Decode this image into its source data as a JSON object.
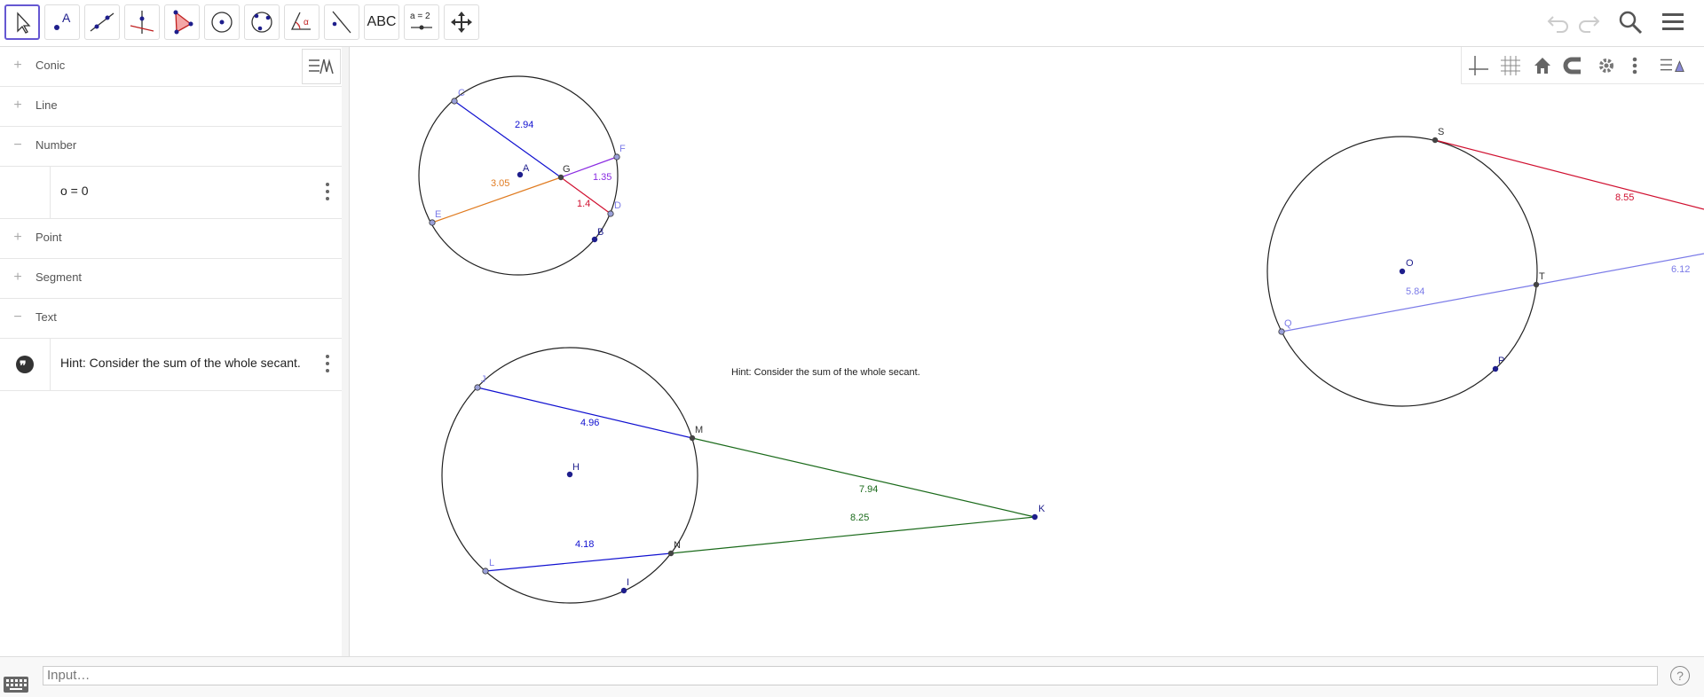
{
  "toolbar": {
    "tools": [
      {
        "name": "move-tool"
      },
      {
        "name": "point-tool",
        "text": "A"
      },
      {
        "name": "line-tool"
      },
      {
        "name": "perpendicular-line-tool"
      },
      {
        "name": "polygon-tool"
      },
      {
        "name": "circle-center-point-tool"
      },
      {
        "name": "circle-three-points-tool"
      },
      {
        "name": "angle-tool",
        "text": "α"
      },
      {
        "name": "reflect-tool"
      },
      {
        "name": "text-tool",
        "text": "ABC"
      },
      {
        "name": "slider-tool",
        "text": "a = 2"
      },
      {
        "name": "move-graphics-view-tool"
      }
    ],
    "right_icons": [
      "undo-icon",
      "redo-icon",
      "search-icon",
      "menu-icon"
    ]
  },
  "algebra": {
    "groups": [
      {
        "label": "Conic",
        "expanded": false
      },
      {
        "label": "Line",
        "expanded": false
      },
      {
        "label": "Number",
        "expanded": true,
        "items": [
          {
            "value": "o = 0"
          }
        ]
      },
      {
        "label": "Point",
        "expanded": false
      },
      {
        "label": "Segment",
        "expanded": false
      },
      {
        "label": "Text",
        "expanded": true,
        "items": [
          {
            "value": "Hint: Consider the sum of the whole secant."
          }
        ]
      }
    ]
  },
  "graphics": {
    "hint_text": "Hint: Consider the sum of the whole secant.",
    "colors": {
      "blue": "#1010d0",
      "orange": "#e07b20",
      "purple": "#8a2be2",
      "red": "#d01030",
      "green": "#1a6a1a",
      "lavender": "#7b7be8",
      "point_dark": "#1e1e8c"
    },
    "figure1": {
      "points": [
        "C",
        "A",
        "G",
        "F",
        "E",
        "D",
        "B"
      ],
      "labels": [
        "2.94",
        "3.05",
        "1.35",
        "1.4"
      ]
    },
    "figure2": {
      "points": [
        "J",
        "H",
        "M",
        "K",
        "L",
        "N",
        "I"
      ],
      "labels": [
        "4.96",
        "7.94",
        "8.25",
        "4.18"
      ]
    },
    "figure3": {
      "points": [
        "S",
        "O",
        "T",
        "Q",
        "P"
      ],
      "labels": [
        "8.55",
        "5.84",
        "6.12"
      ]
    }
  },
  "input": {
    "placeholder": "Input…",
    "help": "?"
  }
}
